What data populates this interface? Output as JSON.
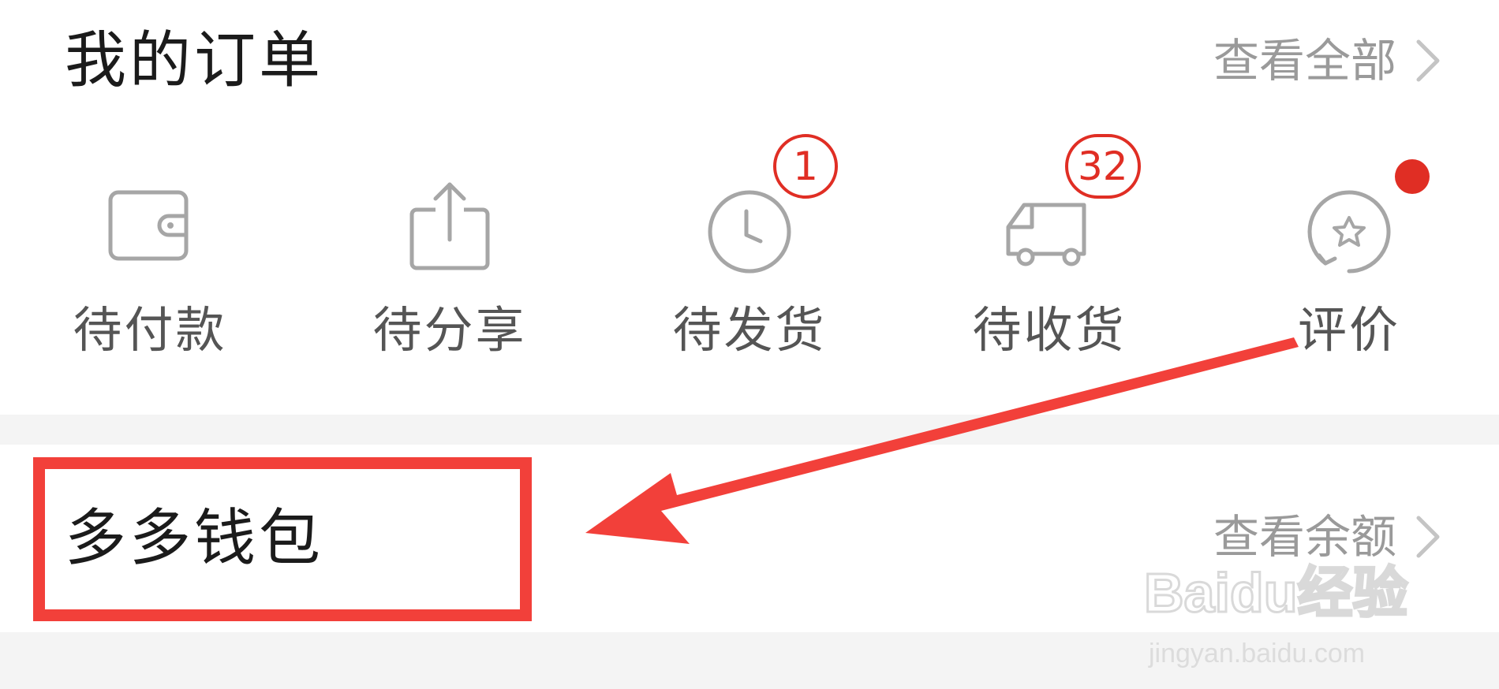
{
  "orders": {
    "title": "我的订单",
    "view_all_label": "查看全部",
    "items": [
      {
        "label": "待付款",
        "icon": "wallet-icon"
      },
      {
        "label": "待分享",
        "icon": "share-icon"
      },
      {
        "label": "待发货",
        "icon": "clock-icon",
        "badge": "1"
      },
      {
        "label": "待收货",
        "icon": "truck-icon",
        "badge": "32"
      },
      {
        "label": "评价",
        "icon": "review-star-icon",
        "dot": true
      }
    ]
  },
  "wallet": {
    "title": "多多钱包",
    "view_balance_label": "查看余额"
  },
  "watermark": {
    "brand": "Baidu经验",
    "url": "jingyan.baidu.com"
  },
  "colors": {
    "accent": "#e02e24",
    "annotation": "#f2403a",
    "muted_text": "#9a9a9a",
    "icon_gray": "#a6a6a6",
    "band": "#f4f4f4"
  }
}
